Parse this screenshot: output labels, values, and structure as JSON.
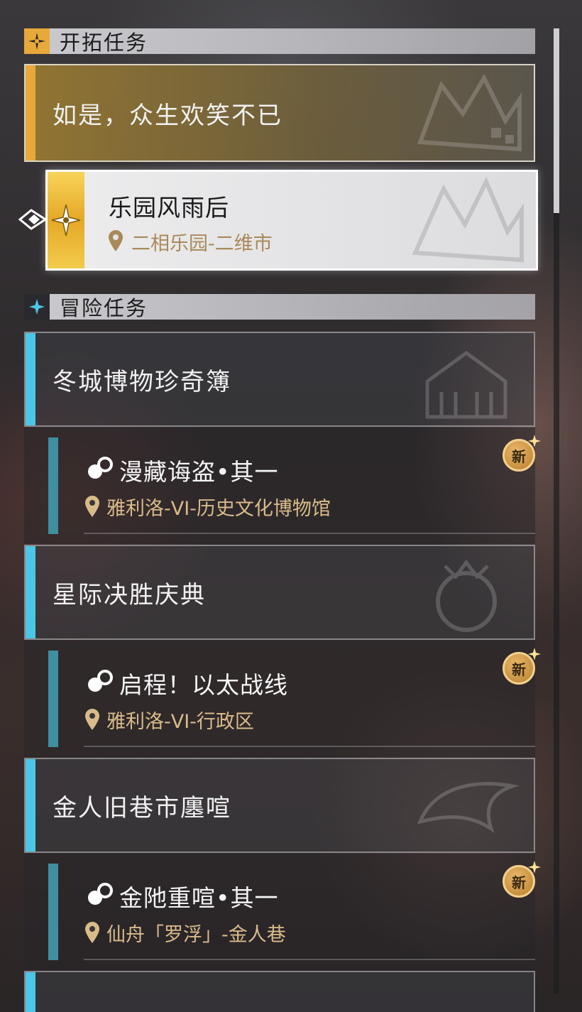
{
  "sections": {
    "trailblaze": {
      "title": "开拓任务",
      "group": {
        "title": "如是，众生欢笑不已"
      },
      "current": {
        "title": "乐园风雨后",
        "location": "二相乐园-二维市"
      }
    },
    "adventure": {
      "title": "冒险任务",
      "groups": [
        {
          "title": "冬城博物珍奇簿",
          "quest": {
            "title": "漫藏诲盗•其一",
            "location": "雅利洛-VI-历史文化博物馆",
            "badge": "新"
          }
        },
        {
          "title": "星际决胜庆典",
          "quest": {
            "title": "启程！以太战线",
            "location": "雅利洛-VI-行政区",
            "badge": "新"
          }
        },
        {
          "title": "金人旧巷市廛喧",
          "quest": {
            "title": "金阤重喧•其一",
            "location": "仙舟「罗浮」-金人巷",
            "badge": "新"
          }
        }
      ]
    }
  },
  "colors": {
    "trailblaze_accent": "#e7a93a",
    "adventure_accent": "#4cc6e6",
    "location_text": "#d9bb8a",
    "badge": "#d19a45"
  },
  "icons": {
    "trailblaze_section": "trailblaze-star-icon",
    "adventure_section": "sparkle-icon",
    "quest_type": "adventure-quest-icon",
    "location": "location-pin-icon",
    "tracking": "tracking-arrow-icon"
  }
}
